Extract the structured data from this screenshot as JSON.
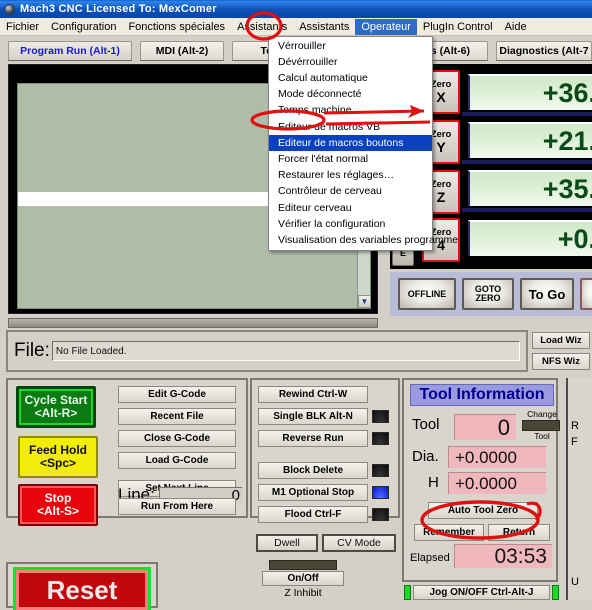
{
  "window": {
    "title": "Mach3 CNC  Licensed To: MexComer",
    "logo_icon": "app-logo-icon"
  },
  "menubar": {
    "items": [
      {
        "label": "Fichier",
        "active": false
      },
      {
        "label": "Configuration",
        "active": false
      },
      {
        "label": "Fonctions spéciales",
        "active": false
      },
      {
        "label": "Assistants",
        "active": false
      },
      {
        "label": "Operateur",
        "active": true
      },
      {
        "label": "PlugIn Control",
        "active": false
      },
      {
        "label": "Aide",
        "active": false
      }
    ]
  },
  "dropdown": {
    "owner": "Operateur",
    "items": [
      {
        "label": "Vérrouiller",
        "selected": false
      },
      {
        "label": "Dévérrouiller",
        "selected": false
      },
      {
        "label": "Calcul automatique",
        "selected": false
      },
      {
        "label": "Mode déconnecté",
        "selected": false
      },
      {
        "label": "Temps machine",
        "selected": false
      },
      {
        "label": "Editeur de macros VB",
        "selected": false
      },
      {
        "label": "Editeur de macros boutons",
        "selected": true
      },
      {
        "label": "Forcer l'état normal",
        "selected": false
      },
      {
        "label": "Restaurer les réglages…",
        "selected": false
      },
      {
        "label": "Contrôleur de cerveau",
        "selected": false
      },
      {
        "label": "Editeur cerveau",
        "selected": false
      },
      {
        "label": "Vérifier la configuration",
        "selected": false
      },
      {
        "label": "Visualisation des variables programme",
        "selected": false
      }
    ]
  },
  "tabs": [
    {
      "label": "Program Run (Alt-1)",
      "active": true
    },
    {
      "label": "MDI (Alt-2)",
      "active": false
    },
    {
      "label": "Tool Path",
      "active": false
    },
    {
      "label": "ngs (Alt-6)",
      "active": false
    },
    {
      "label": "Diagnostics (Alt-7",
      "active": false
    }
  ],
  "gcode_view": {
    "scroll_down_icon": "chevron-down-icon"
  },
  "dro": {
    "home_label": "HOME",
    "axes": [
      {
        "zero_label": "Zero",
        "axis": "X",
        "value": "+36."
      },
      {
        "zero_label": "Zero",
        "axis": "Y",
        "value": "+21."
      },
      {
        "zero_label": "Zero",
        "axis": "Z",
        "value": "+35."
      },
      {
        "zero_label": "Zero",
        "axis": "4",
        "value": "+0."
      }
    ]
  },
  "mode_buttons": [
    {
      "label": "OFFLINE"
    },
    {
      "label_line1": "GOTO",
      "label_line2": "ZERO"
    },
    {
      "label": "To Go"
    }
  ],
  "file_bar": {
    "label": "File:",
    "value": "No File Loaded.",
    "placeholder": "No File Loaded."
  },
  "wizards": [
    {
      "label": "Load Wiz"
    },
    {
      "label": "NFS Wiz"
    }
  ],
  "run_controls": {
    "cycle_start": {
      "line1": "Cycle Start",
      "line2": "<Alt-R>"
    },
    "feed_hold": {
      "line1": "Feed Hold",
      "line2": "<Spc>"
    },
    "stop": {
      "line1": "Stop",
      "line2": "<Alt-S>"
    },
    "gcode_buttons": [
      {
        "label": "Edit G-Code"
      },
      {
        "label": "Recent File"
      },
      {
        "label": "Close G-Code"
      },
      {
        "label": "Load G-Code"
      }
    ],
    "set_next_line": "Set Next Line",
    "line_label": "Line:",
    "line_value": "0",
    "run_from_here": "Run From Here"
  },
  "middle_panel": {
    "buttons": [
      {
        "label": "Rewind Ctrl-W",
        "led": null
      },
      {
        "label": "Single BLK Alt-N",
        "led": "off"
      },
      {
        "label": "Reverse Run",
        "led": "off"
      },
      {
        "label": "Block Delete",
        "led": "off"
      },
      {
        "label": "M1 Optional Stop",
        "led": "on"
      },
      {
        "label": "Flood Ctrl-F",
        "led": "off"
      }
    ],
    "dwell": "Dwell",
    "cv_mode": "CV Mode"
  },
  "z_inhibit": {
    "on_off": "On/Off",
    "caption": "Z Inhibit"
  },
  "tool_info": {
    "header": "Tool Information",
    "tool_label": "Tool",
    "tool_value": "0",
    "change_tool_line1": "Change",
    "change_tool_line2": "Tool",
    "dia_label": "Dia.",
    "dia_value": "+0.0000",
    "h_label": "H",
    "h_value": "+0.0000",
    "auto_tool_zero": "Auto Tool Zero",
    "remember": "Remember",
    "return": "Return",
    "elapsed_label": "Elapsed",
    "elapsed_value": "03:53"
  },
  "jog": {
    "label": "Jog ON/OFF Ctrl-Alt-J"
  },
  "reset": {
    "label": "Reset"
  },
  "cut_panel": {
    "frag1": "R",
    "frag2": "F",
    "frag3": "U"
  },
  "annotations": {
    "oval_menu": "red-oval-operateur",
    "oval_menuitem": "red-oval-editeur-macros-boutons",
    "oval_autotoolzero": "red-oval-auto-tool-zero",
    "color": "#e01010"
  },
  "colors": {
    "titlebar": "#0b4fb5",
    "menu_highlight": "#316ac5",
    "dropdown_selected": "#0a41c0",
    "dro_green": "#cfe8c7",
    "dro_text": "#0a4a18",
    "gcode_bg": "#afbca8",
    "pink_field": "#f0b7bd",
    "tool_header": "#9a9ae0",
    "annotation_red": "#e01010",
    "panel_face": "#d9d5cd"
  }
}
